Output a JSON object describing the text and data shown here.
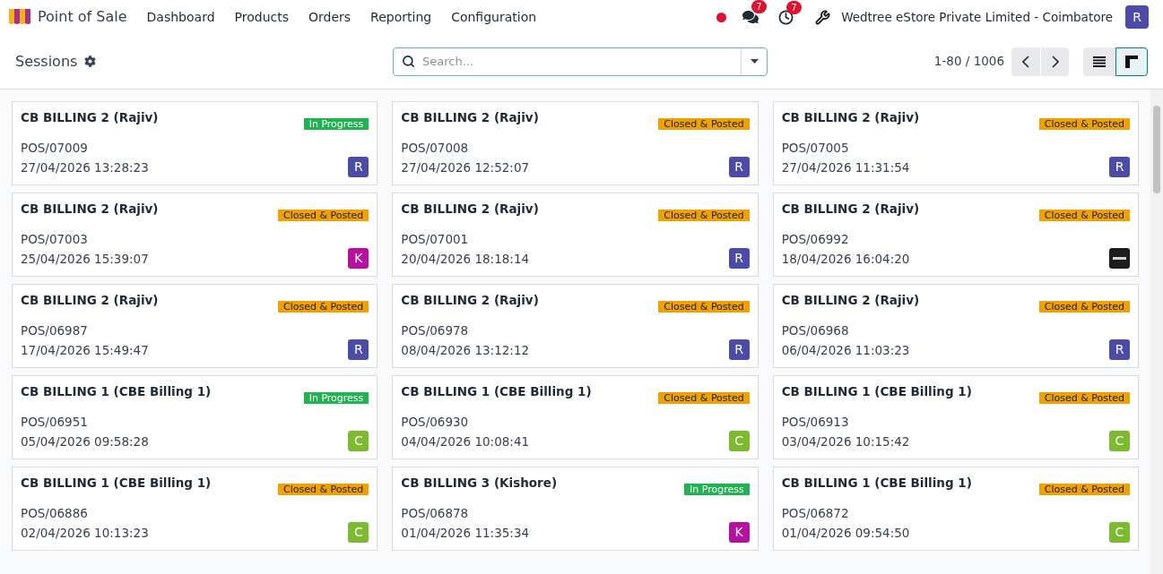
{
  "app": {
    "name": "Point of Sale"
  },
  "menu": [
    "Dashboard",
    "Products",
    "Orders",
    "Reporting",
    "Configuration"
  ],
  "systray": {
    "messages_count": "7",
    "activities_count": "7",
    "company": "Wedtree eStore Private Limited - Coimbatore",
    "user_initial": "R"
  },
  "control_panel": {
    "title": "Sessions",
    "search": {
      "placeholder": "Search..."
    },
    "pager": "1-80 / 1006",
    "views": [
      {
        "kind": "list",
        "selected": false
      },
      {
        "kind": "kanban",
        "selected": true
      }
    ]
  },
  "sessions": [
    {
      "title": "CB BILLING 2 (Rajiv)",
      "ref": "POS/07009",
      "date": "27/04/2026 13:28:23",
      "status": {
        "kind": "progress",
        "label": "In Progress"
      },
      "avatar": {
        "kind": "letter",
        "initial": "R",
        "color": "#4c4ca8"
      }
    },
    {
      "title": "CB BILLING 2 (Rajiv)",
      "ref": "POS/07008",
      "date": "27/04/2026 12:52:07",
      "status": {
        "kind": "closed",
        "label": "Closed & Posted"
      },
      "avatar": {
        "kind": "letter",
        "initial": "R",
        "color": "#4c4ca8"
      }
    },
    {
      "title": "CB BILLING 2 (Rajiv)",
      "ref": "POS/07005",
      "date": "27/04/2026 11:31:54",
      "status": {
        "kind": "closed",
        "label": "Closed & Posted"
      },
      "avatar": {
        "kind": "letter",
        "initial": "R",
        "color": "#4c4ca8"
      }
    },
    {
      "title": "CB BILLING 2 (Rajiv)",
      "ref": "POS/07003",
      "date": "25/04/2026 15:39:07",
      "status": {
        "kind": "closed",
        "label": "Closed & Posted"
      },
      "avatar": {
        "kind": "letter",
        "initial": "K",
        "color": "#b5109f"
      }
    },
    {
      "title": "CB BILLING 2 (Rajiv)",
      "ref": "POS/07001",
      "date": "20/04/2026 18:18:14",
      "status": {
        "kind": "closed",
        "label": "Closed & Posted"
      },
      "avatar": {
        "kind": "letter",
        "initial": "R",
        "color": "#4c4ca8"
      }
    },
    {
      "title": "CB BILLING 2 (Rajiv)",
      "ref": "POS/06992",
      "date": "18/04/2026 16:04:20",
      "status": {
        "kind": "closed",
        "label": "Closed & Posted"
      },
      "avatar": {
        "kind": "image"
      }
    },
    {
      "title": "CB BILLING 2 (Rajiv)",
      "ref": "POS/06987",
      "date": "17/04/2026 15:49:47",
      "status": {
        "kind": "closed",
        "label": "Closed & Posted"
      },
      "avatar": {
        "kind": "letter",
        "initial": "R",
        "color": "#4c4ca8"
      }
    },
    {
      "title": "CB BILLING 2 (Rajiv)",
      "ref": "POS/06978",
      "date": "08/04/2026 13:12:12",
      "status": {
        "kind": "closed",
        "label": "Closed & Posted"
      },
      "avatar": {
        "kind": "letter",
        "initial": "R",
        "color": "#4c4ca8"
      }
    },
    {
      "title": "CB BILLING 2 (Rajiv)",
      "ref": "POS/06968",
      "date": "06/04/2026 11:03:23",
      "status": {
        "kind": "closed",
        "label": "Closed & Posted"
      },
      "avatar": {
        "kind": "letter",
        "initial": "R",
        "color": "#4c4ca8"
      }
    },
    {
      "title": "CB BILLING 1 (CBE Billing 1)",
      "ref": "POS/06951",
      "date": "05/04/2026 09:58:28",
      "status": {
        "kind": "progress",
        "label": "In Progress"
      },
      "avatar": {
        "kind": "letter",
        "initial": "C",
        "color": "#7cbb2f"
      }
    },
    {
      "title": "CB BILLING 1 (CBE Billing 1)",
      "ref": "POS/06930",
      "date": "04/04/2026 10:08:41",
      "status": {
        "kind": "closed",
        "label": "Closed & Posted"
      },
      "avatar": {
        "kind": "letter",
        "initial": "C",
        "color": "#7cbb2f"
      }
    },
    {
      "title": "CB BILLING 1 (CBE Billing 1)",
      "ref": "POS/06913",
      "date": "03/04/2026 10:15:42",
      "status": {
        "kind": "closed",
        "label": "Closed & Posted"
      },
      "avatar": {
        "kind": "letter",
        "initial": "C",
        "color": "#7cbb2f"
      }
    },
    {
      "title": "CB BILLING 1 (CBE Billing 1)",
      "ref": "POS/06886",
      "date": "02/04/2026 10:13:23",
      "status": {
        "kind": "closed",
        "label": "Closed & Posted"
      },
      "avatar": {
        "kind": "letter",
        "initial": "C",
        "color": "#7cbb2f"
      }
    },
    {
      "title": "CB BILLING 3 (Kishore)",
      "ref": "POS/06878",
      "date": "01/04/2026 11:35:34",
      "status": {
        "kind": "progress",
        "label": "In Progress"
      },
      "avatar": {
        "kind": "letter",
        "initial": "K",
        "color": "#b5109f"
      }
    },
    {
      "title": "CB BILLING 1 (CBE Billing 1)",
      "ref": "POS/06872",
      "date": "01/04/2026 09:54:50",
      "status": {
        "kind": "closed",
        "label": "Closed & Posted"
      },
      "avatar": {
        "kind": "letter",
        "initial": "C",
        "color": "#7cbb2f"
      }
    }
  ]
}
